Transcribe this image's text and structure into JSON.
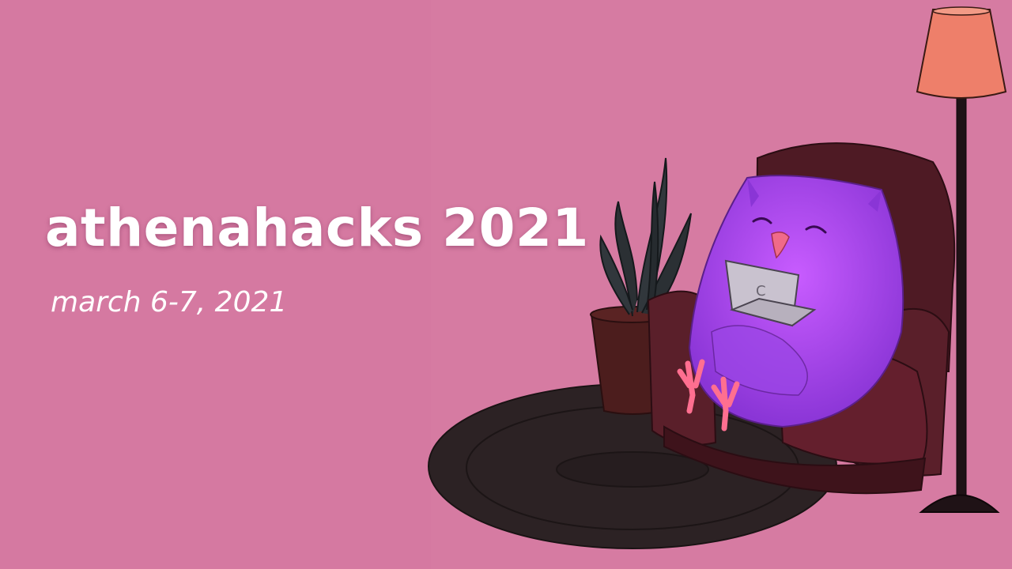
{
  "header": {
    "title": "athenahacks 2021",
    "date": "march 6-7, 2021"
  },
  "illustration": {
    "laptop_logo": "C",
    "icons": [
      "owl-icon",
      "armchair-icon",
      "floor-lamp-icon",
      "potted-plant-icon",
      "rug-icon",
      "laptop-icon"
    ]
  },
  "colors": {
    "background": "#d67ba2",
    "owl": "#9b3fe0",
    "chair": "#5a1f2a",
    "lamp_shade": "#ee7f6a",
    "rug": "#2e2325"
  }
}
